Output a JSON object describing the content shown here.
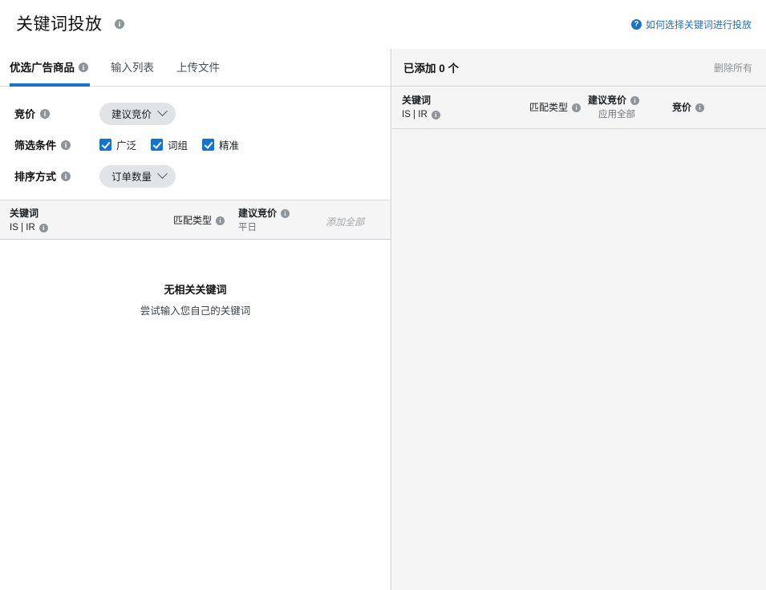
{
  "header": {
    "title": "关键词投放",
    "title_info_icon": "info-icon",
    "help_link": "如何选择关键词进行投放",
    "help_icon": "question-mark-icon"
  },
  "tabs": [
    {
      "label": "优选广告商品",
      "active": true,
      "info_icon": "info-icon"
    },
    {
      "label": "输入列表",
      "active": false
    },
    {
      "label": "上传文件",
      "active": false
    }
  ],
  "controls": {
    "bid": {
      "label": "竞价",
      "info_icon": "info-icon",
      "value": "建议竞价",
      "chevron": "chevron-down-icon"
    },
    "filter": {
      "label": "筛选条件",
      "info_icon": "info-icon",
      "options": [
        {
          "label": "广泛",
          "checked": true
        },
        {
          "label": "词组",
          "checked": true
        },
        {
          "label": "精准",
          "checked": true
        }
      ]
    },
    "sort": {
      "label": "排序方式",
      "info_icon": "info-icon",
      "value": "订单数量",
      "chevron": "chevron-down-icon"
    }
  },
  "suggestions_table": {
    "columns": {
      "keyword": {
        "line1": "关键词",
        "line2": "IS | IR",
        "info_icon": "info-icon"
      },
      "match_type": {
        "line1": "匹配类型",
        "info_icon": "info-icon"
      },
      "suggested_bid": {
        "line1": "建议竞价",
        "line2": "平日",
        "info_icon": "info-icon"
      }
    },
    "add_all": "添加全部",
    "empty_title": "无相关关键词",
    "empty_subtitle": "尝试输入您自己的关键词"
  },
  "added_panel": {
    "count_label": "已添加 0 个",
    "delete_all": "删除所有",
    "columns": {
      "keyword": {
        "line1": "关键词",
        "line2": "IS | IR",
        "info_icon": "info-icon"
      },
      "match_type": {
        "line1": "匹配类型",
        "info_icon": "info-icon"
      },
      "suggested_bid": {
        "line1": "建议竞价",
        "line2": "应用全部",
        "info_icon": "info-icon"
      },
      "bid": {
        "line1": "竞价",
        "info_icon": "info-icon"
      }
    }
  },
  "colors": {
    "accent": "#1073d6",
    "link": "#1473cc",
    "checkbox": "#1473cc",
    "panel_bg": "#f5f5f5",
    "pill_bg": "#e1e4e7",
    "muted_text": "#8a8f94"
  }
}
